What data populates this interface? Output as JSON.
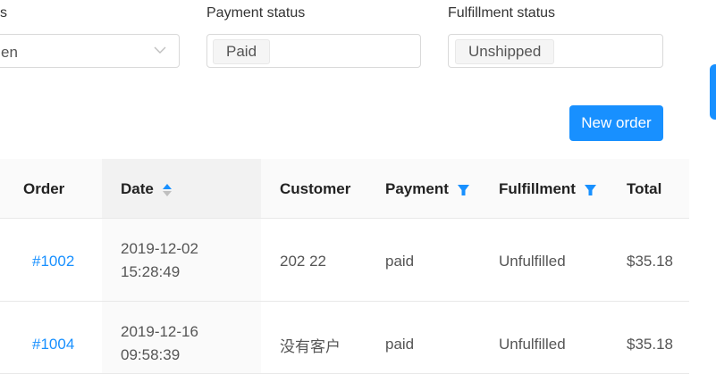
{
  "filters": {
    "first": {
      "label": "s",
      "value": "en"
    },
    "payment": {
      "label": "Payment status",
      "tag": "Paid"
    },
    "fulfillment": {
      "label": "Fulfillment status",
      "tag": "Unshipped"
    }
  },
  "actions": {
    "new_order": "New order"
  },
  "table": {
    "headers": {
      "order": "Order",
      "date": "Date",
      "customer": "Customer",
      "payment": "Payment",
      "fulfillment": "Fulfillment",
      "total": "Total"
    },
    "rows": [
      {
        "order": "#1002",
        "date": "2019-12-02",
        "time": "15:28:49",
        "customer": "202 22",
        "payment": "paid",
        "fulfillment": "Unfulfilled",
        "total": "$35.18"
      },
      {
        "order": "#1004",
        "date": "2019-12-16",
        "time": "09:58:39",
        "customer": "没有客户",
        "payment": "paid",
        "fulfillment": "Unfulfilled",
        "total": "$35.18"
      }
    ]
  },
  "colors": {
    "accent": "#1890ff",
    "header_bg": "#fafafa",
    "border": "#e8e8e8"
  },
  "icons": {
    "dropdown": "chevron-down-icon",
    "sort": "sort-icon",
    "filter": "filter-icon"
  }
}
